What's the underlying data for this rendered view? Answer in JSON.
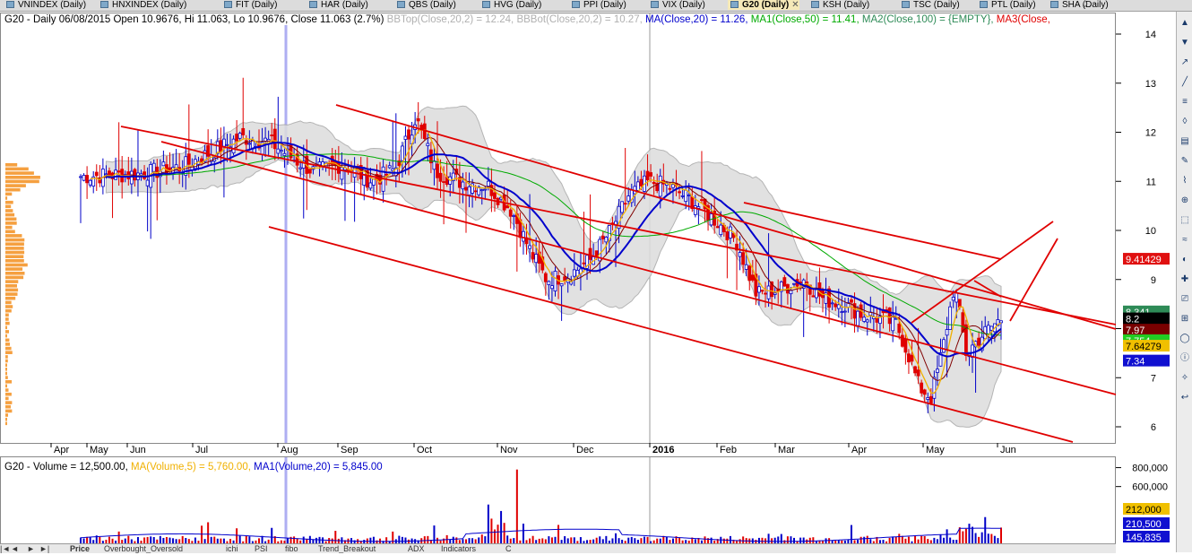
{
  "tabs": [
    {
      "label": "VNINDEX (Daily)",
      "active": false
    },
    {
      "label": "HNXINDEX (Daily)",
      "active": false
    },
    {
      "label": "FIT (Daily)",
      "active": false
    },
    {
      "label": "HAR (Daily)",
      "active": false
    },
    {
      "label": "QBS (Daily)",
      "active": false
    },
    {
      "label": "HVG (Daily)",
      "active": false
    },
    {
      "label": "PPI (Daily)",
      "active": false
    },
    {
      "label": "VIX (Daily)",
      "active": false
    },
    {
      "label": "G20 (Daily)",
      "active": true
    },
    {
      "label": "KSH (Daily)",
      "active": false
    },
    {
      "label": "TSC (Daily)",
      "active": false
    },
    {
      "label": "PTL (Daily)",
      "active": false
    },
    {
      "label": "SHA (Daily)",
      "active": false
    }
  ],
  "add_tab_symbol": "◊",
  "bottom_tabs": [
    "Price",
    "Overbought_Oversold",
    "ichi",
    "PSI",
    "fibo",
    "Trend_Breakout",
    "ADX",
    "Indicators",
    "C"
  ],
  "nav_symbols": [
    "|◄",
    "◄",
    "►",
    "►|"
  ],
  "chart_data": [
    {
      "type": "candlestick",
      "header": {
        "main": "G20 - Daily 06/08/2015 Open 10.9676, Hi 11.063, Lo 10.9676, Close 11.063 (2.7%)",
        "bbtop": "BBTop(Close,20,2) = 12.24,",
        "bbbot": "BBBot(Close,20,2) = 10.27,",
        "ma": "MA(Close,20) = 11.26,",
        "ma1": "MA1(Close,50) = 11.41,",
        "ma2": "MA2(Close,100) = {EMPTY},",
        "ma3": "MA3(Close,"
      },
      "y_ticks": [
        "14",
        "13",
        "12",
        "11",
        "10",
        "9",
        "8",
        "7",
        "6"
      ],
      "x_ticks": [
        "Apr",
        "May",
        "Jun",
        "Jul",
        "Aug",
        "Sep",
        "Oct",
        "Nov",
        "Dec",
        "2016",
        "Feb",
        "Mar",
        "Apr",
        "May",
        "Jun"
      ],
      "ylim": [
        5.7,
        14.3
      ],
      "value_labels": [
        {
          "text": "9.41429",
          "value": 9.41429,
          "bg": "#e01010",
          "fg": "#ffffff"
        },
        {
          "text": "8.341",
          "value": 8.341,
          "bg": "#2e8b57",
          "fg": "#ffffff"
        },
        {
          "text": "8.2",
          "value": 8.2,
          "bg": "#000000",
          "fg": "#ffffff"
        },
        {
          "text": "7.97",
          "value": 7.97,
          "bg": "#7a0000",
          "fg": "#ffffff"
        },
        {
          "text": "7.754",
          "value": 7.754,
          "bg": "#22cc22",
          "fg": "#ffffff"
        },
        {
          "text": "7.64279",
          "value": 7.64279,
          "bg": "#f0c000",
          "fg": "#000000"
        },
        {
          "text": "7.34",
          "value": 7.34,
          "bg": "#1010d0",
          "fg": "#ffffff"
        }
      ],
      "colors": {
        "up": "#0000c8",
        "down": "#e00000",
        "ma20": "#0000cc",
        "ma50": "#00aa00",
        "ma100": "#2e8b57",
        "ma_fast": "#f0b000",
        "ma_slow": "#800000",
        "band": "#d8d8d8",
        "trend": "#e00000",
        "volume_profile": "#f5a040"
      }
    },
    {
      "type": "bar",
      "header": {
        "main": "G20 - Volume = 12,500.00,",
        "ma": "MA(Volume,5) = 5,760.00,",
        "ma1": "MA1(Volume,20) = 5,845.00"
      },
      "y_ticks": [
        "800,000",
        "600,000"
      ],
      "ylim": [
        0,
        900000
      ],
      "value_labels": [
        {
          "text": "212,000",
          "value": 212000,
          "bg": "#f0c000",
          "fg": "#000000"
        },
        {
          "text": "210,500",
          "value": 210500,
          "bg": "#1010d0",
          "fg": "#ffffff"
        },
        {
          "text": "145,835",
          "value": 145835,
          "bg": "#1010d0",
          "fg": "#ffffff"
        }
      ]
    }
  ]
}
